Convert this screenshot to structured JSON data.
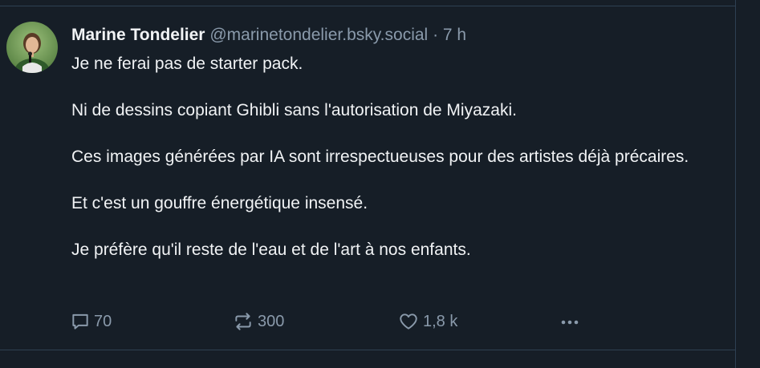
{
  "post": {
    "author_name": "Marine Tondelier",
    "author_handle": "@marinetondelier.bsky.social",
    "separator": "·",
    "time_ago": "7 h",
    "paragraphs": [
      "Je ne ferai pas de starter pack.",
      "Ni de dessins copiant Ghibli sans l'autorisation de Miyazaki.",
      "Ces images générées par IA sont irrespectueuses pour des artistes déjà précaires.",
      "Et c'est un gouffre énergétique insensé.",
      "Je préfère qu'il reste de l'eau et de l'art à nos enfants."
    ],
    "actions": {
      "reply_icon": "reply-icon",
      "reply_count": "70",
      "repost_icon": "repost-icon",
      "repost_count": "300",
      "like_icon": "heart-icon",
      "like_count": "1,8 k",
      "more_icon": "more-dots-icon"
    }
  },
  "colors": {
    "background": "#161e27",
    "divider": "#2e4052",
    "text_primary": "#f1f3f5",
    "text_secondary": "#8a9aab"
  }
}
